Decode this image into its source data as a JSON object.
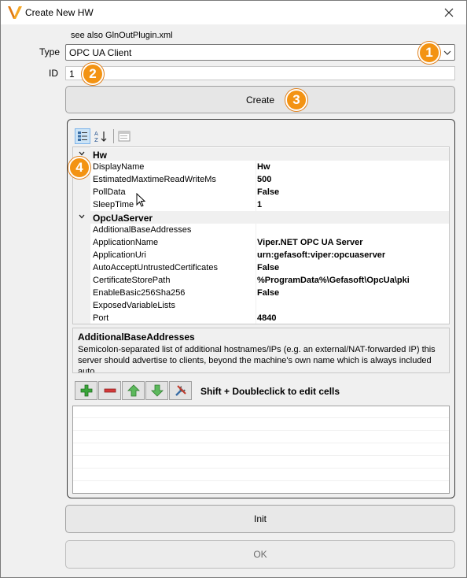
{
  "window": {
    "title": "Create New HW",
    "close_icon": "close-icon",
    "logo_icon": "viper-logo-icon"
  },
  "hint": "see also GlnOutPlugin.xml",
  "form": {
    "type_label": "Type",
    "type_value": "OPC UA Client",
    "id_label": "ID",
    "id_value": "1",
    "create_label": "Create"
  },
  "badges": [
    "1",
    "2",
    "3",
    "4"
  ],
  "property_grid": {
    "toolbar": [
      "categorized-icon",
      "alphabetical-icon",
      "property-pages-icon"
    ],
    "categories": [
      {
        "name": "Hw",
        "expanded": true,
        "properties": [
          {
            "name": "DisplayName",
            "value": "Hw"
          },
          {
            "name": "EstimatedMaxtimeReadWriteMs",
            "value": "500"
          },
          {
            "name": "PollData",
            "value": "False"
          },
          {
            "name": "SleepTime",
            "value": "1"
          }
        ]
      },
      {
        "name": "OpcUaServer",
        "expanded": true,
        "properties": [
          {
            "name": "AdditionalBaseAddresses",
            "value": ""
          },
          {
            "name": "ApplicationName",
            "value": "Viper.NET OPC UA Server"
          },
          {
            "name": "ApplicationUri",
            "value": "urn:gefasoft:viper:opcuaserver"
          },
          {
            "name": "AutoAcceptUntrustedCertificates",
            "value": "False"
          },
          {
            "name": "CertificateStorePath",
            "value": "%ProgramData%\\Gefasoft\\OpcUa\\pki"
          },
          {
            "name": "EnableBasic256Sha256",
            "value": "False"
          },
          {
            "name": "ExposedVariableLists",
            "value": ""
          },
          {
            "name": "Port",
            "value": "4840"
          }
        ]
      }
    ],
    "description": {
      "title": "AdditionalBaseAddresses",
      "text": "Semicolon-separated list of additional hostnames/IPs (e.g. an external/NAT-forwarded IP) this server should advertise to clients, beyond the machine's own name which is always included auto..."
    }
  },
  "actions": {
    "icons": [
      "add-icon",
      "remove-icon",
      "move-up-icon",
      "move-down-icon",
      "edit-tools-icon"
    ],
    "hint": "Shift + Doubleclick to edit cells"
  },
  "buttons": {
    "init": "Init",
    "ok": "OK"
  },
  "colors": {
    "accent": "#f39313",
    "window_bg": "#f0f0f0"
  }
}
